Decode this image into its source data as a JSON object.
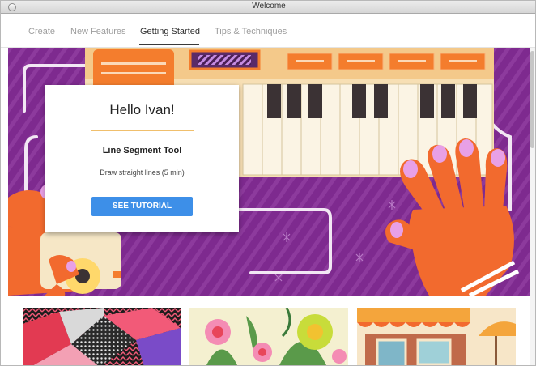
{
  "window": {
    "title": "Welcome"
  },
  "tabs": [
    {
      "label": "Create",
      "active": false
    },
    {
      "label": "New Features",
      "active": false
    },
    {
      "label": "Getting Started",
      "active": true
    },
    {
      "label": "Tips & Techniques",
      "active": false
    }
  ],
  "card": {
    "greeting": "Hello Ivan!",
    "tool_name": "Line Segment Tool",
    "description": "Draw straight lines (5 min)",
    "button_label": "SEE TUTORIAL"
  },
  "colors": {
    "hero_purple": "#7e2a8f",
    "accent_orange": "#f26a2e",
    "button_blue": "#3d8fe8",
    "divider_gold": "#f0bf6c"
  },
  "icons": {
    "close": "close-icon"
  }
}
